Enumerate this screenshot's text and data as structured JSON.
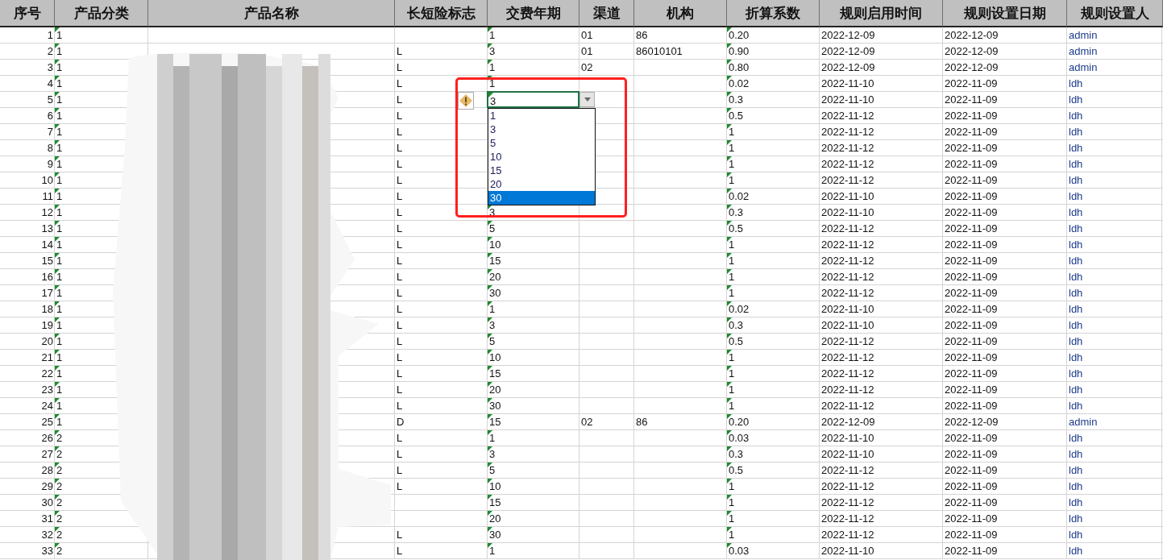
{
  "columns": [
    {
      "label": "序号"
    },
    {
      "label": "产品分类",
      "text_marker": true
    },
    {
      "label": "产品名称"
    },
    {
      "label": "长短险标志"
    },
    {
      "label": "交费年期",
      "text_marker": true
    },
    {
      "label": "渠道"
    },
    {
      "label": "机构"
    },
    {
      "label": "折算系数",
      "text_marker": true
    },
    {
      "label": "规则启用时间"
    },
    {
      "label": "规则设置日期"
    },
    {
      "label": "规则设置人"
    }
  ],
  "rows": [
    {
      "no": "1",
      "cat": "1",
      "years": "1",
      "ch": "01",
      "org": "86",
      "coef": "0.20",
      "start": "2022-12-09",
      "set": "2022-12-09",
      "by": "admin"
    },
    {
      "no": "2",
      "cat": "1",
      "flag": "L",
      "years": "3",
      "ch": "01",
      "org": "86010101",
      "coef": "0.90",
      "start": "2022-12-09",
      "set": "2022-12-09",
      "by": "admin"
    },
    {
      "no": "3",
      "cat": "1",
      "flag": "L",
      "years": "1",
      "ch": "02",
      "coef": "0.80",
      "start": "2022-12-09",
      "set": "2022-12-09",
      "by": "admin"
    },
    {
      "no": "4",
      "cat": "1",
      "flag": "L",
      "years": "1",
      "coef": "0.02",
      "start": "2022-11-10",
      "set": "2022-11-09",
      "by": "ldh"
    },
    {
      "no": "5",
      "cat": "1",
      "flag": "L",
      "years": "3",
      "coef": "0.3",
      "start": "2022-11-10",
      "set": "2022-11-09",
      "by": "ldh",
      "warning": true,
      "dropdown": {
        "options": [
          {
            "label": "1",
            "selected": false
          },
          {
            "label": "3",
            "selected": false
          },
          {
            "label": "5",
            "selected": false
          },
          {
            "label": "10",
            "selected": false
          },
          {
            "label": "15",
            "selected": false
          },
          {
            "label": "20",
            "selected": false
          },
          {
            "label": "30",
            "selected": true
          }
        ]
      }
    },
    {
      "no": "6",
      "cat": "1",
      "flag": "L",
      "coef": "0.5",
      "start": "2022-11-12",
      "set": "2022-11-09",
      "by": "ldh"
    },
    {
      "no": "7",
      "cat": "1",
      "flag": "L",
      "coef": "1",
      "start": "2022-11-12",
      "set": "2022-11-09",
      "by": "ldh"
    },
    {
      "no": "8",
      "cat": "1",
      "flag": "L",
      "coef": "1",
      "start": "2022-11-12",
      "set": "2022-11-09",
      "by": "ldh"
    },
    {
      "no": "9",
      "cat": "1",
      "flag": "L",
      "coef": "1",
      "start": "2022-11-12",
      "set": "2022-11-09",
      "by": "ldh"
    },
    {
      "no": "10",
      "cat": "1",
      "flag": "L",
      "coef": "1",
      "start": "2022-11-12",
      "set": "2022-11-09",
      "by": "ldh"
    },
    {
      "no": "11",
      "cat": "1",
      "flag": "L",
      "coef": "0.02",
      "start": "2022-11-10",
      "set": "2022-11-09",
      "by": "ldh"
    },
    {
      "no": "12",
      "cat": "1",
      "flag": "L",
      "years": "3",
      "coef": "0.3",
      "start": "2022-11-10",
      "set": "2022-11-09",
      "by": "ldh"
    },
    {
      "no": "13",
      "cat": "1",
      "flag": "L",
      "years": "5",
      "coef": "0.5",
      "start": "2022-11-12",
      "set": "2022-11-09",
      "by": "ldh"
    },
    {
      "no": "14",
      "cat": "1",
      "flag": "L",
      "years": "10",
      "coef": "1",
      "start": "2022-11-12",
      "set": "2022-11-09",
      "by": "ldh"
    },
    {
      "no": "15",
      "cat": "1",
      "flag": "L",
      "years": "15",
      "coef": "1",
      "start": "2022-11-12",
      "set": "2022-11-09",
      "by": "ldh"
    },
    {
      "no": "16",
      "cat": "1",
      "flag": "L",
      "years": "20",
      "coef": "1",
      "start": "2022-11-12",
      "set": "2022-11-09",
      "by": "ldh"
    },
    {
      "no": "17",
      "cat": "1",
      "flag": "L",
      "years": "30",
      "coef": "1",
      "start": "2022-11-12",
      "set": "2022-11-09",
      "by": "ldh"
    },
    {
      "no": "18",
      "cat": "1",
      "flag": "L",
      "years": "1",
      "coef": "0.02",
      "start": "2022-11-10",
      "set": "2022-11-09",
      "by": "ldh"
    },
    {
      "no": "19",
      "cat": "1",
      "flag": "L",
      "years": "3",
      "coef": "0.3",
      "start": "2022-11-10",
      "set": "2022-11-09",
      "by": "ldh"
    },
    {
      "no": "20",
      "cat": "1",
      "flag": "L",
      "years": "5",
      "coef": "0.5",
      "start": "2022-11-12",
      "set": "2022-11-09",
      "by": "ldh"
    },
    {
      "no": "21",
      "cat": "1",
      "flag": "L",
      "years": "10",
      "coef": "1",
      "start": "2022-11-12",
      "set": "2022-11-09",
      "by": "ldh"
    },
    {
      "no": "22",
      "cat": "1",
      "flag": "L",
      "years": "15",
      "coef": "1",
      "start": "2022-11-12",
      "set": "2022-11-09",
      "by": "ldh"
    },
    {
      "no": "23",
      "cat": "1",
      "flag": "L",
      "years": "20",
      "coef": "1",
      "start": "2022-11-12",
      "set": "2022-11-09",
      "by": "ldh"
    },
    {
      "no": "24",
      "cat": "1",
      "flag": "L",
      "years": "30",
      "coef": "1",
      "start": "2022-11-12",
      "set": "2022-11-09",
      "by": "ldh"
    },
    {
      "no": "25",
      "cat": "1",
      "flag": "D",
      "years": "15",
      "ch": "02",
      "org": "86",
      "coef": "0.20",
      "start": "2022-12-09",
      "set": "2022-12-09",
      "by": "admin"
    },
    {
      "no": "26",
      "cat": "2",
      "flag": "L",
      "years": "1",
      "coef": "0.03",
      "start": "2022-11-10",
      "set": "2022-11-09",
      "by": "ldh"
    },
    {
      "no": "27",
      "cat": "2",
      "flag": "L",
      "years": "3",
      "coef": "0.3",
      "start": "2022-11-10",
      "set": "2022-11-09",
      "by": "ldh"
    },
    {
      "no": "28",
      "cat": "2",
      "flag": "L",
      "years": "5",
      "coef": "0.5",
      "start": "2022-11-12",
      "set": "2022-11-09",
      "by": "ldh"
    },
    {
      "no": "29",
      "cat": "2",
      "flag": "L",
      "years": "10",
      "coef": "1",
      "start": "2022-11-12",
      "set": "2022-11-09",
      "by": "ldh"
    },
    {
      "no": "30",
      "cat": "2",
      "years": "15",
      "coef": "1",
      "start": "2022-11-12",
      "set": "2022-11-09",
      "by": "ldh"
    },
    {
      "no": "31",
      "cat": "2",
      "years": "20",
      "coef": "1",
      "start": "2022-11-12",
      "set": "2022-11-09",
      "by": "ldh"
    },
    {
      "no": "32",
      "cat": "2",
      "flag": "L",
      "years": "30",
      "coef": "1",
      "start": "2022-11-12",
      "set": "2022-11-09",
      "by": "ldh"
    },
    {
      "no": "33",
      "cat": "2",
      "flag": "L",
      "years": "1",
      "coef": "0.03",
      "start": "2022-11-10",
      "set": "2022-11-09",
      "by": "ldh"
    }
  ],
  "annotation": {
    "kind": "frame"
  }
}
